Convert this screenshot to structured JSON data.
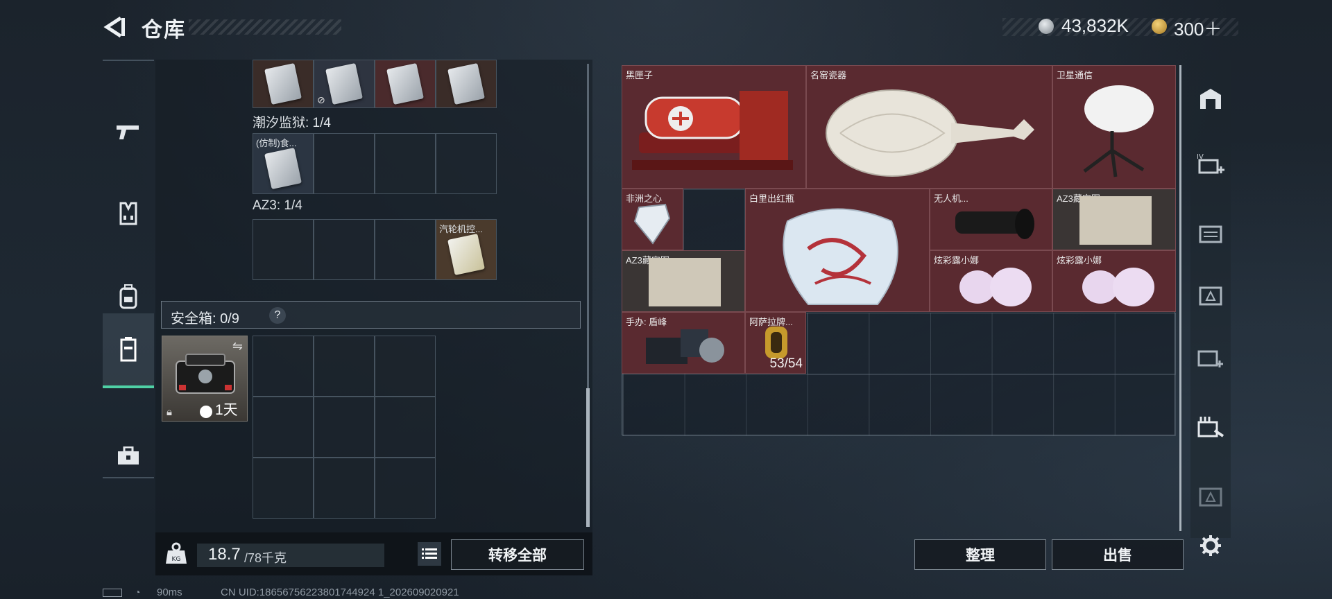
{
  "header": {
    "title": "仓库",
    "currency1": "43,832K",
    "currency2": "300＋"
  },
  "sidebar": {
    "items": [
      "weapon-icon",
      "armor-icon",
      "backpack-icon",
      "container-icon",
      "case-icon"
    ],
    "active_index": 3
  },
  "left": {
    "section1_label": "潮汐监狱: 1/4",
    "section1_item": "(仿制)食...",
    "section2_label": "AZ3: 1/4",
    "section2_item": "汽轮机控...",
    "safe_label": "安全箱: 0/9",
    "help": "?",
    "safe_timer": "1天",
    "weight_value": "18.7",
    "weight_max": "/78千克",
    "transfer_all": "转移全部"
  },
  "warehouse": {
    "items": [
      {
        "label": "黑匣子",
        "kind": "blackbox"
      },
      {
        "label": "名窑瓷器",
        "kind": "vase"
      },
      {
        "label": "卫星通信",
        "kind": "satellite"
      },
      {
        "label": "非洲之心",
        "kind": "diamond"
      },
      {
        "label": "白里出红瓶",
        "kind": "redvase"
      },
      {
        "label": "无人机...",
        "kind": "drone"
      },
      {
        "label": "AZ3藏宝图...",
        "kind": "map"
      },
      {
        "label": "AZ3藏宝图...",
        "kind": "map"
      },
      {
        "label": "炫彩露小娜",
        "kind": "figure"
      },
      {
        "label": "炫彩露小娜",
        "kind": "figure"
      },
      {
        "label": "手办: 盾峰",
        "kind": "mech"
      },
      {
        "label": "阿萨拉牌...",
        "kind": "card"
      }
    ],
    "card_count": "53/54",
    "sort_button": "整理",
    "sell_button": "出售"
  },
  "footer": {
    "ping": "90ms",
    "uid": "CN UID:18656756223801744924 1_202609020921"
  },
  "colors": {
    "accent": "#4fd1a5",
    "item_red": "#5a2a30",
    "panel_border": "#55626e"
  }
}
